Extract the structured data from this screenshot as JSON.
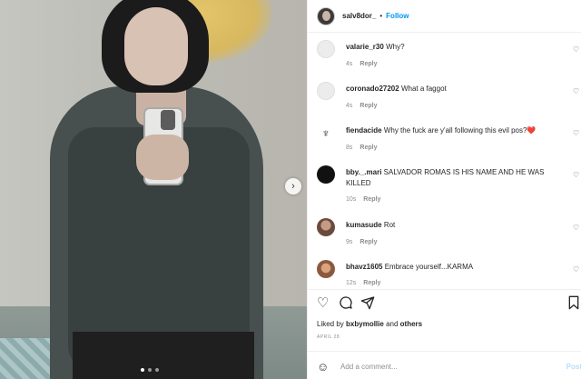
{
  "header": {
    "username": "salv8dor_",
    "separator": "•",
    "follow_label": "Follow"
  },
  "comments": [
    {
      "username": "valarie_r30",
      "text": "Why?",
      "time": "4s",
      "reply": "Reply",
      "avatar": "blank-avatar"
    },
    {
      "username": "coronado27202",
      "text": "What a faggot",
      "time": "4s",
      "reply": "Reply",
      "avatar": "blank-avatar"
    },
    {
      "username": "fiendacide",
      "text": "Why the fuck are y'all following this evil pos?",
      "emoji": "❤️",
      "time": "8s",
      "reply": "Reply",
      "avatar": "logo-avatar"
    },
    {
      "username": "bby._.mari",
      "text": "SALVADOR ROMAS IS HIS NAME AND HE WAS KILLED",
      "time": "10s",
      "reply": "Reply",
      "avatar": "black-avatar"
    },
    {
      "username": "kumasude",
      "text": "Rot",
      "time": "9s",
      "reply": "Reply",
      "avatar": "photo-avatar"
    },
    {
      "username": "bhavz1605",
      "text": "Embrace yourself...KARMA",
      "time": "12s",
      "reply": "Reply",
      "avatar": "photo-avatar"
    }
  ],
  "actions": {
    "like_icon": "heart-icon",
    "comment_icon": "comment-icon",
    "share_icon": "share-icon",
    "save_icon": "bookmark-icon"
  },
  "likes": {
    "prefix": "Liked by",
    "user": "bxbymollie",
    "conjunction": "and",
    "others": "others"
  },
  "date": "APRIL 28",
  "add_comment": {
    "placeholder": "Add a comment...",
    "post_label": "Post",
    "emoji_icon": "smiley-icon"
  },
  "colors": {
    "accent": "#0095f6",
    "post_disabled": "#b2dffc",
    "muted": "#8e8e8e",
    "heart_emoji": "#e0245e"
  }
}
